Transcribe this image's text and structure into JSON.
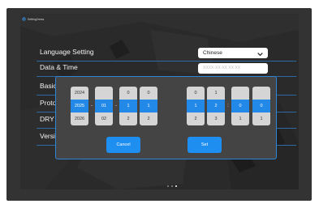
{
  "header": {
    "title": "Setting2ness"
  },
  "settings": {
    "language": {
      "label": "Language Setting",
      "value": "Chinese"
    },
    "datetime": {
      "label": "Data & Time",
      "placeholder": "XXXX-XX-XX XX:XX"
    },
    "basic": {
      "label": "Basic"
    },
    "protocol": {
      "label": "Proto"
    },
    "dry": {
      "label": "DRY C"
    },
    "version": {
      "label": "Versi"
    }
  },
  "picker": {
    "columns": [
      [
        "2024",
        "2025",
        "2026"
      ],
      [
        "",
        "01",
        "02"
      ],
      [
        "0",
        "1",
        "2"
      ],
      [
        "0",
        "1",
        "2"
      ],
      [
        "0",
        "1",
        "2"
      ],
      [
        "1",
        "2",
        "3"
      ],
      [
        "",
        "0",
        "1"
      ],
      [
        "",
        "0",
        "1"
      ]
    ],
    "separators": [
      "-",
      "-",
      ":"
    ],
    "cancel_label": "Cancel",
    "set_label": "Set"
  },
  "pager": {
    "count": 3,
    "active_index": 2
  },
  "colors": {
    "accent": "#2289e8",
    "line": "#2e6aa3",
    "dialog_border": "#2f86d9"
  }
}
